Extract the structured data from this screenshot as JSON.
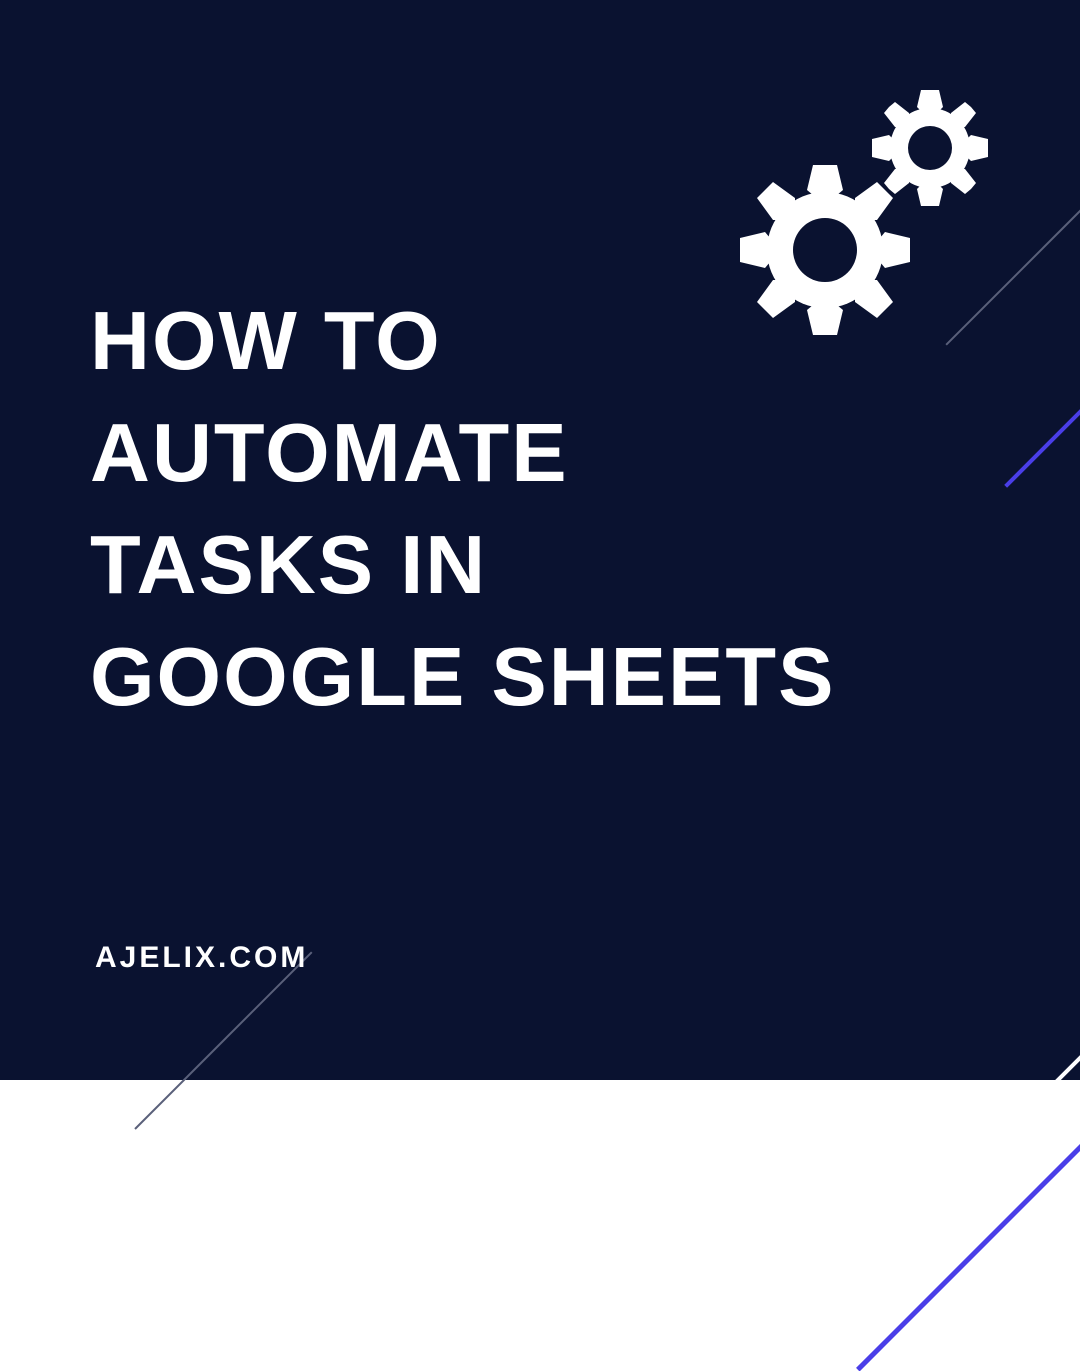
{
  "headline": {
    "line1": "HOW TO",
    "line2": "AUTOMATE",
    "line3": "TASKS IN",
    "line4": "GOOGLE SHEETS"
  },
  "brand": "AJELIX.COM",
  "colors": {
    "background": "#0a1230",
    "text": "#ffffff",
    "accent_purple": "#4a3ee8",
    "accent_gray": "#5a607a"
  },
  "icon": "gears-icon"
}
